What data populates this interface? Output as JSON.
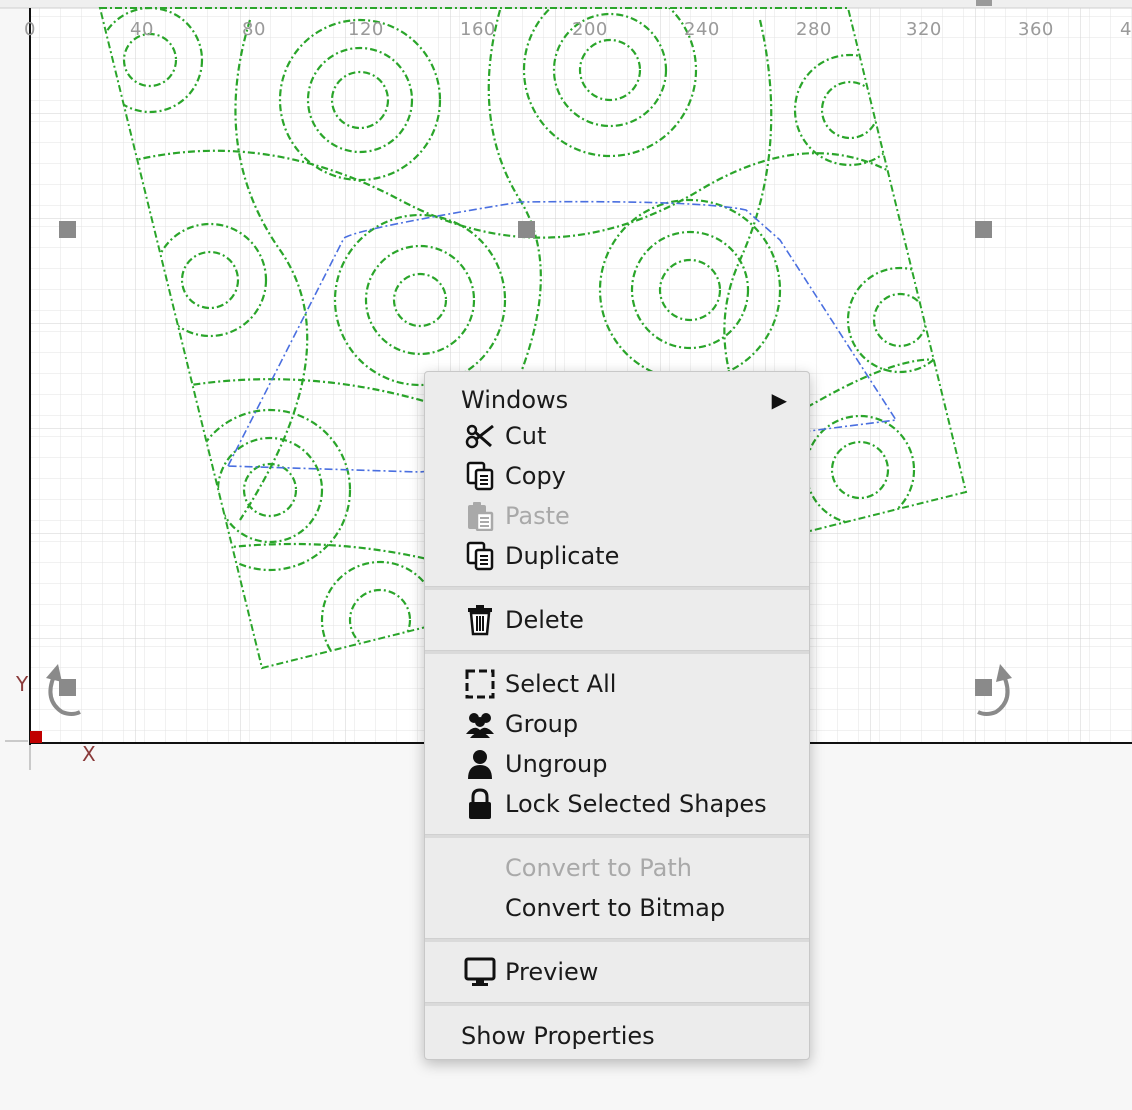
{
  "ruler": {
    "ticks": [
      "0",
      "40",
      "80",
      "120",
      "160",
      "200",
      "240",
      "280",
      "320",
      "360",
      "4"
    ]
  },
  "axes": {
    "y_label": "Y",
    "x_label": "X"
  },
  "colors": {
    "canvas_bg": "#f7f7f7",
    "grid_line": "#dcdcdc",
    "shape_stroke": "#2aa52a",
    "selection_path": "#4a6fe0",
    "handle": "#8a8a8a",
    "origin_marker": "#c00000",
    "menu_bg": "#ececec",
    "menu_text": "#1a1a1a",
    "menu_text_disabled": "#a9a9a9"
  },
  "context_menu": {
    "windows": {
      "label": "Windows",
      "icon": "submenu-arrow-icon"
    },
    "cut": {
      "label": "Cut",
      "icon": "scissors-icon"
    },
    "copy": {
      "label": "Copy",
      "icon": "copy-icon"
    },
    "paste": {
      "label": "Paste",
      "icon": "paste-icon",
      "disabled": true
    },
    "duplicate": {
      "label": "Duplicate",
      "icon": "duplicate-icon"
    },
    "delete": {
      "label": "Delete",
      "icon": "trash-icon"
    },
    "select_all": {
      "label": "Select All",
      "icon": "select-all-icon"
    },
    "group": {
      "label": "Group",
      "icon": "group-icon"
    },
    "ungroup": {
      "label": "Ungroup",
      "icon": "user-icon"
    },
    "lock": {
      "label": "Lock Selected Shapes",
      "icon": "lock-icon"
    },
    "convert_path": {
      "label": "Convert to Path",
      "disabled": true
    },
    "convert_bitmap": {
      "label": "Convert to Bitmap"
    },
    "preview": {
      "label": "Preview",
      "icon": "monitor-icon"
    },
    "show_properties": {
      "label": "Show Properties"
    }
  }
}
